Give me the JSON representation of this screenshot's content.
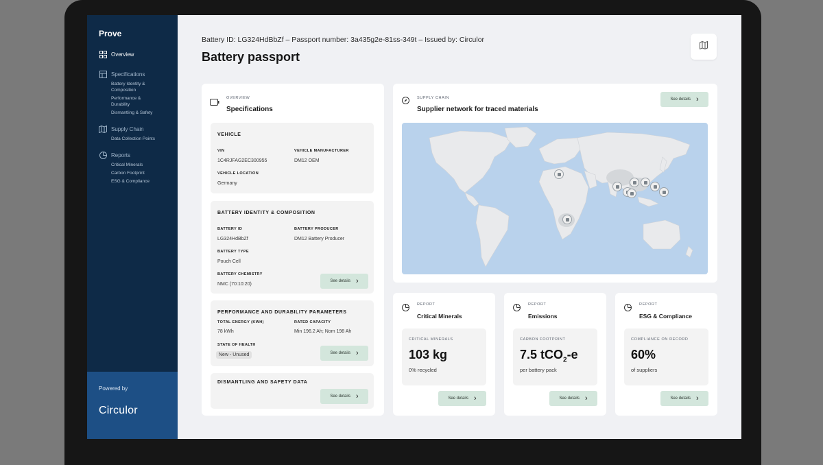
{
  "app": {
    "brand": "Prove"
  },
  "sidebar": {
    "items": [
      {
        "label": "Overview",
        "icon": "grid-icon",
        "active": true,
        "subs": []
      },
      {
        "label": "Specifications",
        "icon": "table-icon",
        "active": false,
        "subs": [
          "Battery Identity & Composition",
          "Performance & Durability",
          "Dismantling & Safety"
        ]
      },
      {
        "label": "Supply Chain",
        "icon": "map-icon",
        "active": false,
        "subs": [
          "Data Collection Points"
        ]
      },
      {
        "label": "Reports",
        "icon": "pie-chart-icon",
        "active": false,
        "subs": [
          "Critical Minerals",
          "Carbon Footprint",
          "ESG & Compliance"
        ]
      }
    ],
    "powered_by": "Powered by",
    "logo_text": "Circulor"
  },
  "header": {
    "meta": "Battery ID: LG324HdBbZf – Passport number: 3a435g2e-81ss-349t – Issued by: Circulor",
    "title": "Battery passport",
    "map_toggle_icon": "map-icon"
  },
  "specs": {
    "eyebrow": "OVERVIEW",
    "title": "Specifications",
    "vehicle": {
      "title": "VEHICLE",
      "vin_label": "VIN",
      "vin": "1C4RJFAG2EC300955",
      "manufacturer_label": "VEHICLE MANUFACTURER",
      "manufacturer": "DM12 OEM",
      "location_label": "VEHICLE LOCATION",
      "location": "Germany"
    },
    "battery": {
      "title": "BATTERY IDENTITY & COMPOSITION",
      "id_label": "BATTERY ID",
      "id": "LG324HdBbZf",
      "producer_label": "BATTERY PRODUCER",
      "producer": "DM12 Battery Producer",
      "type_label": "BATTERY TYPE",
      "type": "Pouch Cell",
      "chemistry_label": "BATTERY CHEMISTRY",
      "chemistry": "NMC (70:10:20)",
      "button": "See details"
    },
    "performance": {
      "title": "PERFORMANCE AND DURABILITY PARAMETERS",
      "energy_label": "TOTAL ENERGY (kWh)",
      "energy": "78 kWh",
      "capacity_label": "RATED CAPACITY",
      "capacity": "Min 196.2 Ah; Nom 198 Ah",
      "health_label": "STATE OF HEALTH",
      "health": "New - Unused",
      "button": "See details"
    },
    "dismantling": {
      "title": "DISMANTLING AND SAFETY DATA",
      "button": "See details"
    }
  },
  "supply_chain": {
    "eyebrow": "SUPPLY CHAIN",
    "title": "Supplier network for traced materials",
    "button": "See details"
  },
  "reports": [
    {
      "eyebrow": "REPORT",
      "title": "Critical Minerals",
      "metric_label": "CRITICAL MINERALS",
      "value": "103 kg",
      "value_sub": "",
      "value_suffix": "",
      "caption": "0% recycled",
      "button": "See details"
    },
    {
      "eyebrow": "REPORT",
      "title": "Emissions",
      "metric_label": "CARBON FOOTPRINT",
      "value": "7.5 tCO",
      "value_sub": "2",
      "value_suffix": "-e",
      "caption": "per battery pack",
      "button": "See details"
    },
    {
      "eyebrow": "REPORT",
      "title": "ESG & Compliance",
      "metric_label": "COMPLIANCE ON RECORD",
      "value": "60%",
      "value_sub": "",
      "value_suffix": "",
      "caption": "of suppliers",
      "button": "See details"
    }
  ],
  "colors": {
    "sidebar": "#0e2a47",
    "powered_panel": "#1d4f85",
    "button_green": "#d3e6dc",
    "map_water": "#b9d2ec",
    "land": "#e9eaec"
  }
}
